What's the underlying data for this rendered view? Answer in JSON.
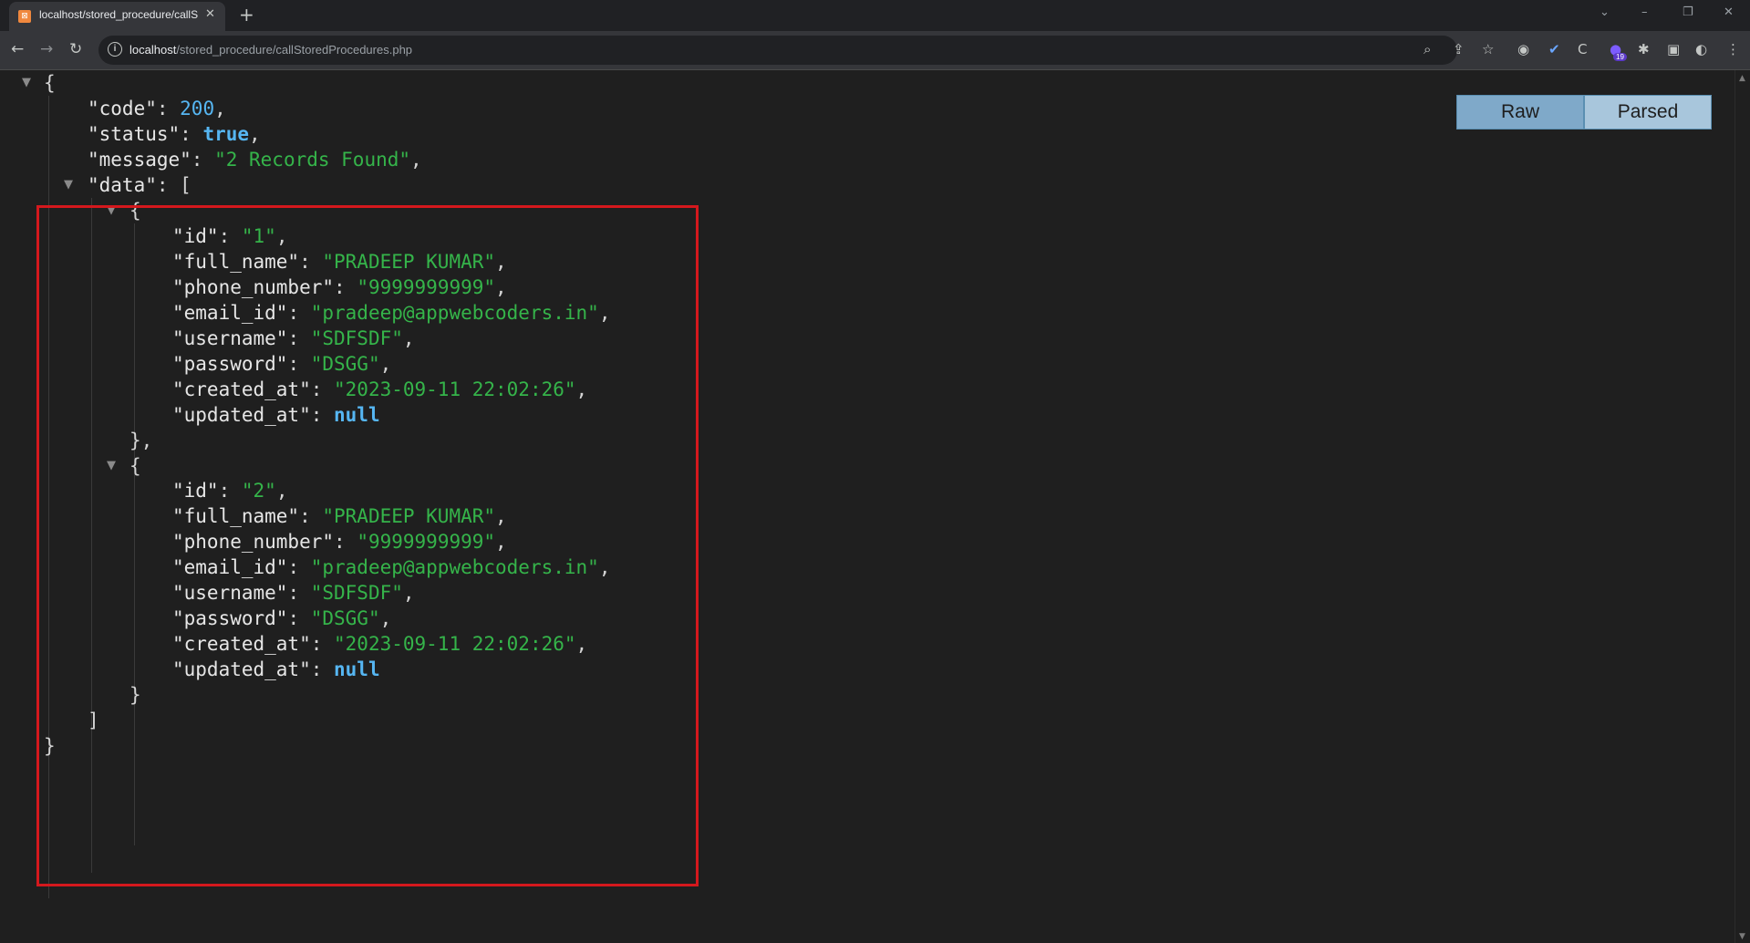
{
  "browser": {
    "tab_title": "localhost/stored_procedure/callS",
    "tab_favicon": "xampp-icon",
    "url_host": "localhost",
    "url_path": "/stored_procedure/callStoredProcedures.php",
    "extension_badge": "19",
    "icons": [
      "back-icon",
      "forward-icon",
      "reload-icon",
      "info-icon",
      "zoom-icon",
      "share-icon",
      "star-icon",
      "camera-extension-icon",
      "check-extension-icon",
      "c-extension-icon",
      "profile-extension-icon",
      "puzzle-icon",
      "sidepanel-icon",
      "profile-avatar-icon",
      "menu-icon"
    ]
  },
  "viewer": {
    "raw_label": "Raw",
    "parsed_label": "Parsed"
  },
  "json": {
    "code_key": "\"code\"",
    "code_value": "200",
    "status_key": "\"status\"",
    "status_value": "true",
    "message_key": "\"message\"",
    "message_value": "\"2 Records Found\"",
    "data_key": "\"data\"",
    "records": [
      {
        "id": "\"1\"",
        "full_name": "\"PRADEEP KUMAR\"",
        "phone_number": "\"9999999999\"",
        "email_id": "\"pradeep@appwebcoders.in\"",
        "username": "\"SDFSDF\"",
        "password": "\"DSGG\"",
        "created_at": "\"2023-09-11 22:02:26\"",
        "updated_at": "null"
      },
      {
        "id": "\"2\"",
        "full_name": "\"PRADEEP KUMAR\"",
        "phone_number": "\"9999999999\"",
        "email_id": "\"pradeep@appwebcoders.in\"",
        "username": "\"SDFSDF\"",
        "password": "\"DSGG\"",
        "created_at": "\"2023-09-11 22:02:26\"",
        "updated_at": "null"
      }
    ],
    "record_keys": [
      "\"id\"",
      "\"full_name\"",
      "\"phone_number\"",
      "\"email_id\"",
      "\"username\"",
      "\"password\"",
      "\"created_at\"",
      "\"updated_at\""
    ]
  },
  "colors": {
    "string": "#35b44a",
    "number": "#56b6f2",
    "highlight_box": "#d4181d"
  }
}
